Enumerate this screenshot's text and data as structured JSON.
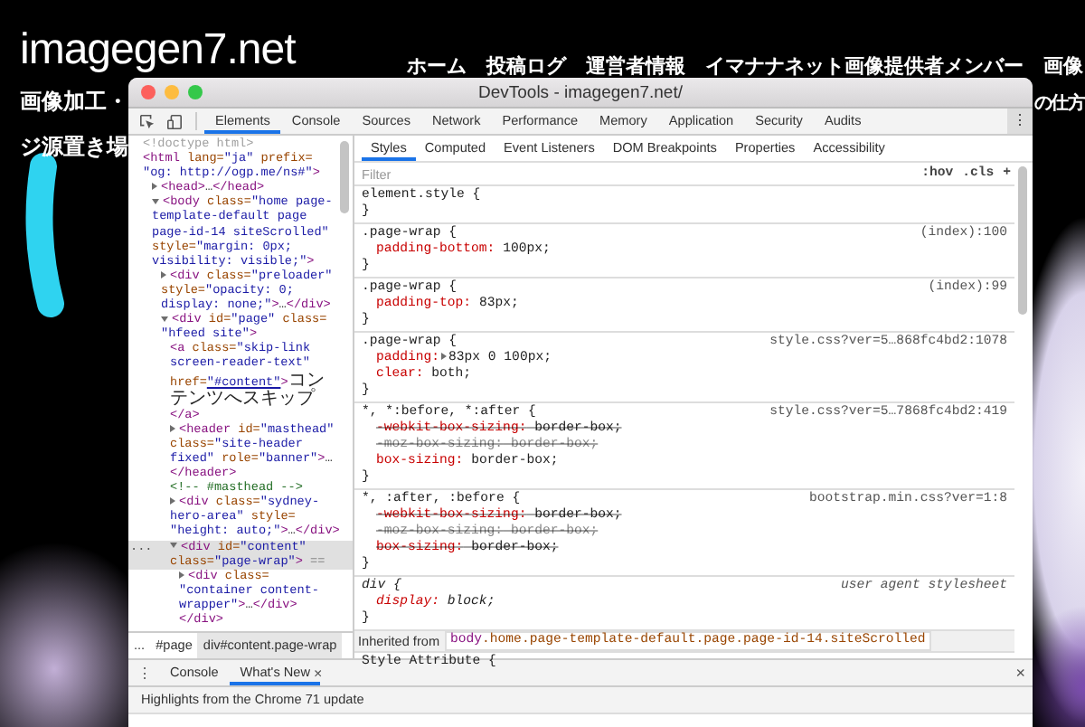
{
  "site": {
    "logo": "imagegen7.net",
    "nav": [
      "ホーム",
      "投稿ログ",
      "運営者情報",
      "イマナナネット画像提供者メンバー",
      "画像"
    ],
    "tagline": [
      "画像加工・",
      "ジ源置き場"
    ],
    "nav_overflow": "の仕方"
  },
  "devtools": {
    "title": "DevTools - imagegen7.net/",
    "tabs": [
      {
        "label": "Elements",
        "selected": true
      },
      {
        "label": "Console",
        "selected": false
      },
      {
        "label": "Sources",
        "selected": false
      },
      {
        "label": "Network",
        "selected": false
      },
      {
        "label": "Performance",
        "selected": false
      },
      {
        "label": "Memory",
        "selected": false
      },
      {
        "label": "Application",
        "selected": false
      },
      {
        "label": "Security",
        "selected": false
      },
      {
        "label": "Audits",
        "selected": false
      }
    ],
    "menu": "⋮",
    "elements_tree": {
      "nodes": [
        {
          "selected": false,
          "parts": [
            {
              "kind": "doctype",
              "text": "<!doctype html>"
            }
          ]
        },
        {
          "selected": false,
          "parts": [
            {
              "kind": "tag",
              "text": "<html"
            },
            {
              "kind": "attr",
              "text": " lang="
            },
            {
              "kind": "value",
              "text": "\"ja\""
            },
            {
              "kind": "attr",
              "text": " prefix="
            },
            {
              "kind": "value",
              "text": "\"og: http://ogp.me/ns#\""
            },
            {
              "kind": "tag",
              "text": ">"
            }
          ],
          "children": [
            {
              "expanded": false,
              "selected": false,
              "parts": [
                {
                  "kind": "tag",
                  "text": "<head>"
                },
                {
                  "kind": "ellipsis",
                  "text": "…"
                },
                {
                  "kind": "tag",
                  "text": "</head>"
                }
              ]
            },
            {
              "expanded": true,
              "selected": false,
              "parts": [
                {
                  "kind": "tag",
                  "text": "<body"
                },
                {
                  "kind": "attr",
                  "text": " class="
                },
                {
                  "kind": "value",
                  "text": "\"home page-template-default page page-id-14 siteScrolled\""
                },
                {
                  "kind": "attr",
                  "text": " style="
                },
                {
                  "kind": "value",
                  "text": "\"margin: 0px; visibility: visible;\""
                },
                {
                  "kind": "tag",
                  "text": ">"
                }
              ],
              "children": [
                {
                  "expanded": false,
                  "selected": false,
                  "parts": [
                    {
                      "kind": "tag",
                      "text": "<div"
                    },
                    {
                      "kind": "attr",
                      "text": " class="
                    },
                    {
                      "kind": "value",
                      "text": "\"preloader\""
                    },
                    {
                      "kind": "attr",
                      "text": " style="
                    },
                    {
                      "kind": "value",
                      "text": "\"opacity: 0; display: none;\""
                    },
                    {
                      "kind": "tag",
                      "text": ">"
                    },
                    {
                      "kind": "ellipsis",
                      "text": "…"
                    },
                    {
                      "kind": "tag",
                      "text": "</div>"
                    }
                  ]
                },
                {
                  "expanded": true,
                  "selected": false,
                  "parts": [
                    {
                      "kind": "tag",
                      "text": "<div"
                    },
                    {
                      "kind": "attr",
                      "text": " id="
                    },
                    {
                      "kind": "value",
                      "text": "\"page\""
                    },
                    {
                      "kind": "attr",
                      "text": " class="
                    },
                    {
                      "kind": "value",
                      "text": "\"hfeed site\""
                    },
                    {
                      "kind": "tag",
                      "text": ">"
                    }
                  ],
                  "children": [
                    {
                      "selected": false,
                      "parts": [
                        {
                          "kind": "tag",
                          "text": "<a"
                        },
                        {
                          "kind": "attr",
                          "text": " class="
                        },
                        {
                          "kind": "value",
                          "text": "\"skip-link screen-reader-text\""
                        },
                        {
                          "kind": "attr",
                          "text": " href="
                        },
                        {
                          "kind": "link",
                          "text": "\"#content\""
                        },
                        {
                          "kind": "tag",
                          "text": ">"
                        },
                        {
                          "kind": "text",
                          "text": "コンテンツへスキップ"
                        },
                        {
                          "kind": "tag",
                          "text": "</a>"
                        }
                      ]
                    },
                    {
                      "expanded": false,
                      "selected": false,
                      "parts": [
                        {
                          "kind": "tag",
                          "text": "<header"
                        },
                        {
                          "kind": "attr",
                          "text": " id="
                        },
                        {
                          "kind": "value",
                          "text": "\"masthead\""
                        },
                        {
                          "kind": "attr",
                          "text": " class="
                        },
                        {
                          "kind": "value",
                          "text": "\"site-header fixed\""
                        },
                        {
                          "kind": "attr",
                          "text": " role="
                        },
                        {
                          "kind": "value",
                          "text": "\"banner\""
                        },
                        {
                          "kind": "tag",
                          "text": ">"
                        },
                        {
                          "kind": "ellipsis",
                          "text": "…"
                        },
                        {
                          "kind": "tag",
                          "text": "</header>"
                        }
                      ]
                    },
                    {
                      "selected": false,
                      "parts": [
                        {
                          "kind": "comment",
                          "text": "<!-- #masthead -->"
                        }
                      ]
                    },
                    {
                      "expanded": false,
                      "selected": false,
                      "parts": [
                        {
                          "kind": "tag",
                          "text": "<div"
                        },
                        {
                          "kind": "attr",
                          "text": " class="
                        },
                        {
                          "kind": "value",
                          "text": "\"sydney-hero-area\""
                        },
                        {
                          "kind": "attr",
                          "text": " style="
                        },
                        {
                          "kind": "value",
                          "text": "\"height: auto;\""
                        },
                        {
                          "kind": "tag",
                          "text": ">"
                        },
                        {
                          "kind": "ellipsis",
                          "text": "…"
                        },
                        {
                          "kind": "tag",
                          "text": "</div>"
                        }
                      ]
                    },
                    {
                      "expanded": true,
                      "selected": true,
                      "gutter": "...",
                      "parts": [
                        {
                          "kind": "tag",
                          "text": "<div"
                        },
                        {
                          "kind": "attr",
                          "text": " id="
                        },
                        {
                          "kind": "value",
                          "text": "\"content\""
                        },
                        {
                          "kind": "attr",
                          "text": " class="
                        },
                        {
                          "kind": "value",
                          "text": "\"page-wrap\""
                        },
                        {
                          "kind": "tag",
                          "text": ">"
                        },
                        {
                          "kind": "marker",
                          "text": " =="
                        }
                      ],
                      "children": [
                        {
                          "expanded": false,
                          "selected": false,
                          "parts": [
                            {
                              "kind": "tag",
                              "text": "<div"
                            },
                            {
                              "kind": "attr",
                              "text": " class="
                            },
                            {
                              "kind": "value",
                              "text": "\"container content-wrapper\""
                            },
                            {
                              "kind": "tag",
                              "text": ">"
                            },
                            {
                              "kind": "ellipsis",
                              "text": "…"
                            },
                            {
                              "kind": "tag",
                              "text": "</div>"
                            }
                          ]
                        },
                        {
                          "selected": false,
                          "parts": [
                            {
                              "kind": "tag",
                              "text": "</div>"
                            }
                          ]
                        }
                      ]
                    }
                  ]
                }
              ]
            }
          ]
        }
      ]
    },
    "breadcrumbs": [
      {
        "label": "...",
        "selected": false
      },
      {
        "label": "#page",
        "selected": false
      },
      {
        "label": "div#content.page-wrap",
        "selected": true
      }
    ],
    "styles_tabs": [
      {
        "label": "Styles",
        "selected": true
      },
      {
        "label": "Computed",
        "selected": false
      },
      {
        "label": "Event Listeners",
        "selected": false
      },
      {
        "label": "DOM Breakpoints",
        "selected": false
      },
      {
        "label": "Properties",
        "selected": false
      },
      {
        "label": "Accessibility",
        "selected": false
      }
    ],
    "filter": {
      "placeholder": "Filter"
    },
    "filter_buttons": [
      ":hov",
      ".cls",
      "+"
    ],
    "rules": [
      {
        "selector": "element.style {",
        "closing": "}",
        "user_agent": false
      },
      {
        "selector": ".page-wrap {",
        "source": "(index):100",
        "closing": "}",
        "user_agent": false,
        "properties": [
          {
            "name": "padding-bottom:",
            "value": "100px;",
            "struck": false,
            "unsupported": false
          }
        ]
      },
      {
        "selector": ".page-wrap {",
        "source": "(index):99",
        "closing": "}",
        "user_agent": false,
        "properties": [
          {
            "name": "padding-top:",
            "value": "83px;",
            "struck": false,
            "unsupported": false
          }
        ]
      },
      {
        "selector": ".page-wrap {",
        "source": "style.css?ver=5…868fc4bd2:1078",
        "closing": "}",
        "user_agent": false,
        "properties": [
          {
            "name": "padding:",
            "value": "83px 0 100px;",
            "struck": false,
            "unsupported": false,
            "shorthand": true
          },
          {
            "name": "clear:",
            "value": "both;",
            "struck": false,
            "unsupported": false
          }
        ]
      },
      {
        "selector": "*, *:before, *:after {",
        "source": "style.css?ver=5…7868fc4bd2:419",
        "closing": "}",
        "user_agent": false,
        "properties": [
          {
            "name": "-webkit-box-sizing:",
            "value": "border-box;",
            "struck": true,
            "unsupported": false
          },
          {
            "name": "-moz-box-sizing:",
            "value": "border-box;",
            "struck": true,
            "unsupported": true
          },
          {
            "name": "box-sizing:",
            "value": "border-box;",
            "struck": false,
            "unsupported": false
          }
        ]
      },
      {
        "selector": "*, :after, :before {",
        "source": "bootstrap.min.css?ver=1:8",
        "closing": "}",
        "user_agent": false,
        "properties": [
          {
            "name": "-webkit-box-sizing:",
            "value": "border-box;",
            "struck": true,
            "unsupported": false
          },
          {
            "name": "-moz-box-sizing:",
            "value": "border-box;",
            "struck": true,
            "unsupported": true
          },
          {
            "name": "box-sizing:",
            "value": "border-box;",
            "struck": true,
            "unsupported": false
          }
        ]
      },
      {
        "selector": "div {",
        "source": "user agent stylesheet",
        "closing": "}",
        "user_agent": true,
        "properties": [
          {
            "name": "display:",
            "value": "block;",
            "struck": false,
            "unsupported": false
          }
        ]
      }
    ],
    "inherited": {
      "label": "Inherited from",
      "element": "body",
      "classes": ".home.page-template-default.page.page-id-14.siteScrolled"
    },
    "style_attribute": "Style Attribute {",
    "drawer": {
      "menu": "⋮",
      "tabs": [
        {
          "label": "Console",
          "selected": false
        },
        {
          "label": "What's New",
          "selected": true,
          "close": "×"
        }
      ],
      "close": "×",
      "message": "Highlights from the Chrome 71 update"
    }
  }
}
